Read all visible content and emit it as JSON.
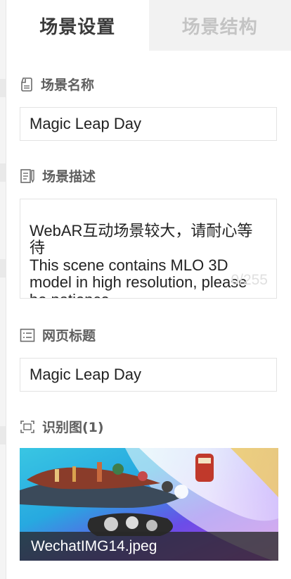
{
  "tabs": [
    {
      "label": "场景设置",
      "active": true
    },
    {
      "label": "场景结构",
      "active": false
    }
  ],
  "scene_name": {
    "label": "场景名称",
    "icon": "document-icon",
    "value": "Magic Leap Day"
  },
  "scene_description": {
    "label": "场景描述",
    "icon": "document-edit-icon",
    "value": "WebAR互动场景较大，请耐心等待\nThis scene contains MLO 3D model in high resolution, please be patience.",
    "counter": "0/255"
  },
  "page_title": {
    "label": "网页标题",
    "icon": "list-icon",
    "value": "Magic Leap Day"
  },
  "recognition_image": {
    "label": "识别图(1)",
    "icon": "scan-frame-icon",
    "filename": "WechatIMG14.jpeg"
  },
  "colors": {
    "active_tab_bg": "#ffffff",
    "inactive_tab_bg": "#f2f2f2",
    "label_text": "#5f5f5f",
    "field_border": "#e3e3e3",
    "filename_overlay": "#282828"
  }
}
